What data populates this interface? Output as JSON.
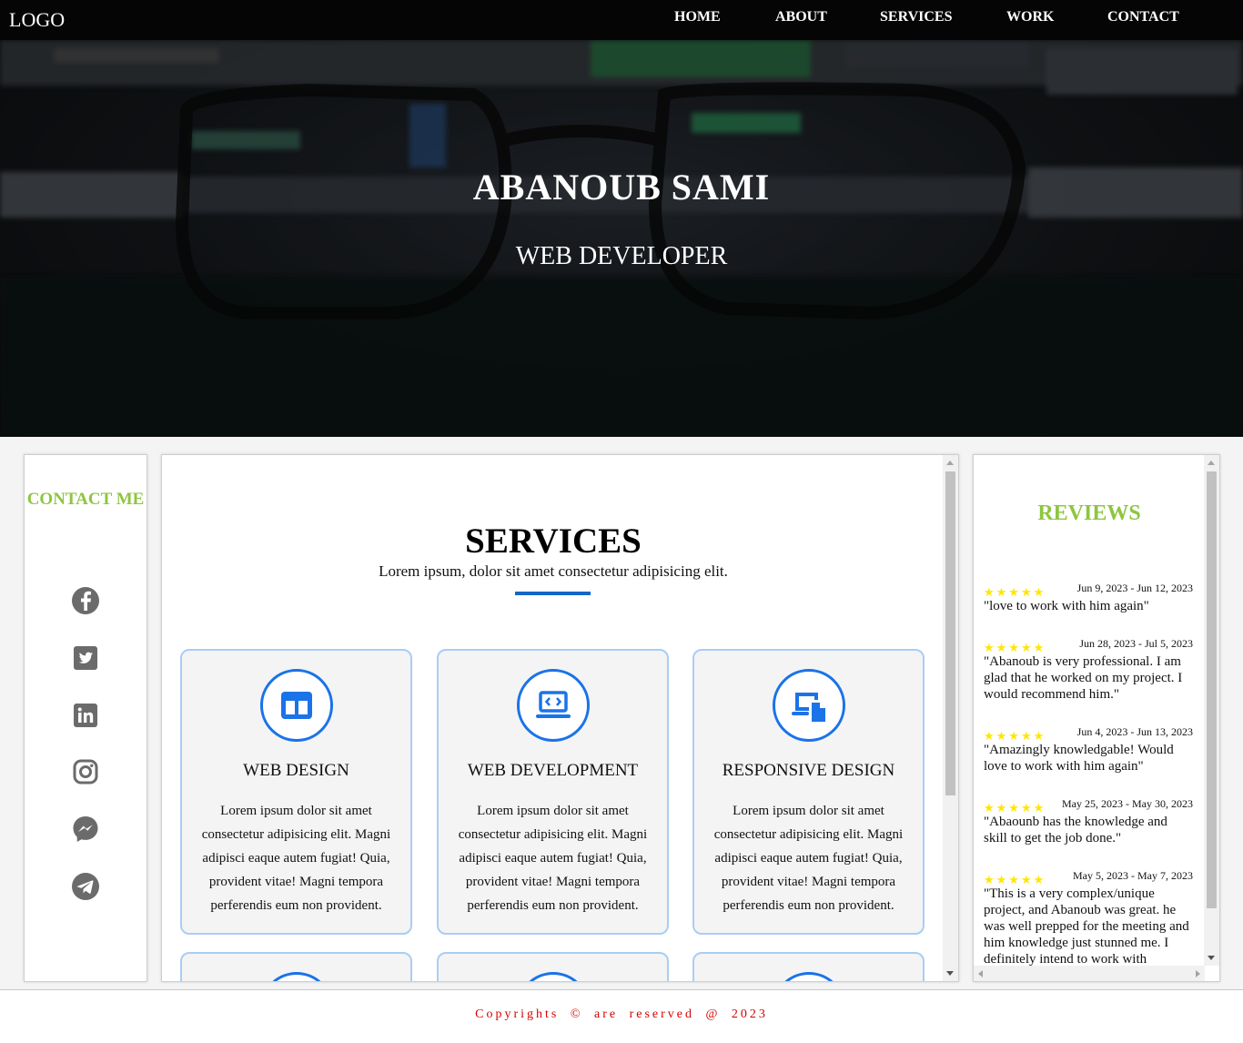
{
  "nav": {
    "logo": "LOGO",
    "links": [
      "HOME",
      "ABOUT",
      "SERVICES",
      "WORK",
      "CONTACT"
    ]
  },
  "hero": {
    "name": "ABANOUB SAMI",
    "role": "WEB DEVELOPER"
  },
  "contact": {
    "title": "CONTACT ME",
    "socials": [
      "facebook-icon",
      "twitter-icon",
      "linkedin-icon",
      "instagram-icon",
      "messenger-icon",
      "telegram-icon"
    ],
    "icon_color": "#6b6b6b"
  },
  "services": {
    "title": "SERVICES",
    "subtitle": "Lorem ipsum, dolor sit amet consectetur adipisicing elit.",
    "accent": "#1a73e8",
    "cards": [
      {
        "icon": "layout-icon",
        "title": "WEB DESIGN",
        "text": "Lorem ipsum dolor sit amet consectetur adipisicing elit. Magni adipisci eaque autem fugiat! Quia, provident vitae! Magni tempora perferendis eum non provident."
      },
      {
        "icon": "laptop-code-icon",
        "title": "WEB DEVELOPMENT",
        "text": "Lorem ipsum dolor sit amet consectetur adipisicing elit. Magni adipisci eaque autem fugiat! Quia, provident vitae! Magni tempora perferendis eum non provident."
      },
      {
        "icon": "devices-icon",
        "title": "RESPONSIVE DESIGN",
        "text": "Lorem ipsum dolor sit amet consectetur adipisicing elit. Magni adipisci eaque autem fugiat! Quia, provident vitae! Magni tempora perferendis eum non provident."
      }
    ]
  },
  "reviews": {
    "title": "REVIEWS",
    "star_color": "#ffe600",
    "items": [
      {
        "stars": "★★★★★",
        "date": "Jun 9, 2023 - Jun 12, 2023",
        "text": "\"love to work with him again\""
      },
      {
        "stars": "★★★★★",
        "date": "Jun 28, 2023 - Jul 5, 2023",
        "text": "\"Abanoub is very professional. I am glad that he worked on my project. I would recommend him.\""
      },
      {
        "stars": "★★★★★",
        "date": "Jun 4, 2023 - Jun 13, 2023",
        "text": "\"Amazingly knowledgable! Would love to work with him again\""
      },
      {
        "stars": "★★★★★",
        "date": "May 25, 2023 - May 30, 2023",
        "text": "\"Abaounb has the knowledge and skill to get the job done.\""
      },
      {
        "stars": "★★★★★",
        "date": "May 5, 2023 - May 7, 2023",
        "text": "\"This is a very complex/unique project, and Abanoub was great. he was well prepped for the meeting and him knowledge just stunned me. I definitely intend to work with"
      }
    ]
  },
  "footer": {
    "copyright": "Copyrights © are reserved @ 2023"
  }
}
